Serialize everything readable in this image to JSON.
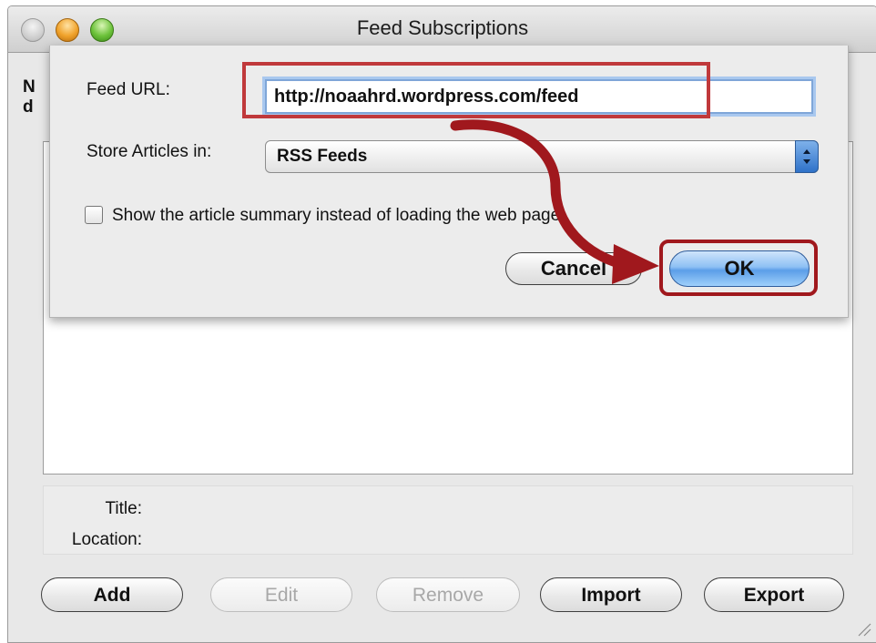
{
  "window": {
    "title": "Feed Subscriptions",
    "left_edge_text_1": "N",
    "left_edge_text_2": "d",
    "info": {
      "title_label": "Title:",
      "location_label": "Location:"
    },
    "buttons": {
      "add": "Add",
      "edit": "Edit",
      "remove": "Remove",
      "import": "Import",
      "export": "Export"
    }
  },
  "sheet": {
    "feed_url_label": "Feed URL:",
    "feed_url_value": "http://noaahrd.wordpress.com/feed",
    "store_label": "Store Articles in:",
    "store_value": "RSS Feeds",
    "summary_checkbox_label": "Show the article summary instead of loading the web page",
    "summary_checked": false,
    "cancel_label": "Cancel",
    "ok_label": "OK"
  },
  "annotations": {
    "highlight_color": "#c0393b",
    "arrow_color": "#a0181d"
  },
  "colors": {
    "ok_button": "#6fb0f0",
    "focus_ring": "#a9c8ef"
  }
}
